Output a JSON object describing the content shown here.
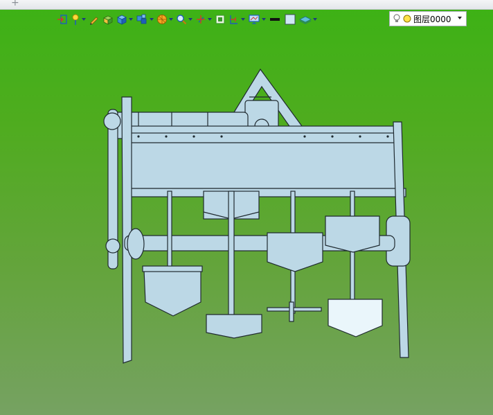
{
  "tabs": {
    "new_tab_symbol": "+"
  },
  "toolbar": {
    "items": [
      {
        "name": "exit-sketch-icon",
        "has_dropdown": false
      },
      {
        "name": "lightbulb-pin-icon",
        "has_dropdown": true
      },
      {
        "name": "pencil-icon",
        "has_dropdown": false
      },
      {
        "name": "solid-box-icon",
        "has_dropdown": false
      },
      {
        "name": "cube-view-icon",
        "has_dropdown": true
      },
      {
        "name": "multi-cube-icon",
        "has_dropdown": true
      },
      {
        "name": "render-sphere-icon",
        "has_dropdown": true
      },
      {
        "name": "zoom-icon",
        "has_dropdown": true
      },
      {
        "name": "pan-axes-icon",
        "has_dropdown": true
      },
      {
        "name": "zoom-fit-icon",
        "has_dropdown": false
      },
      {
        "name": "section-view-icon",
        "has_dropdown": true
      },
      {
        "name": "display-screen-icon",
        "has_dropdown": true
      },
      {
        "name": "line-color-icon",
        "has_dropdown": false
      },
      {
        "name": "face-color-icon",
        "has_dropdown": false
      },
      {
        "name": "layer-style-icon",
        "has_dropdown": true
      }
    ],
    "colors": {
      "icon_blue": "#1f5fb8",
      "icon_green": "#3a9a2a",
      "icon_orange": "#e88a12"
    }
  },
  "layer": {
    "current": "图层0000"
  },
  "viewport": {
    "model_fill": "#bcd8e6",
    "model_stroke": "#1f2a30",
    "background_top": "#3cb215",
    "background_bottom": "#76a262"
  }
}
